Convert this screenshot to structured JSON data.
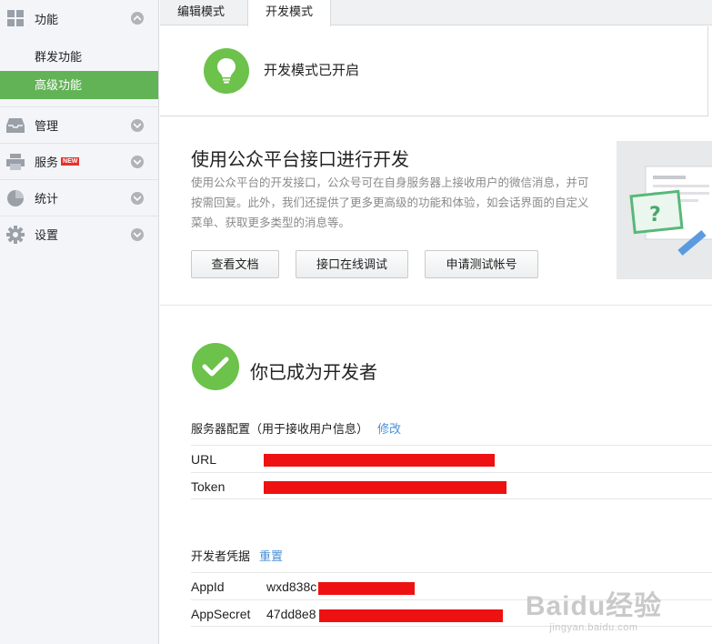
{
  "sidebar": {
    "sections": [
      {
        "label": "功能",
        "items": [
          "群发功能",
          "高级功能"
        ],
        "active_item": 1
      },
      {
        "label": "管理"
      },
      {
        "label": "服务",
        "badge": "NEW"
      },
      {
        "label": "统计"
      },
      {
        "label": "设置"
      }
    ]
  },
  "tabs": [
    "编辑模式",
    "开发模式"
  ],
  "active_tab": 1,
  "status": "开发模式已开启",
  "dev": {
    "title": "使用公众平台接口进行开发",
    "desc": "使用公众平台的开发接口，公众号可在自身服务器上接收用户的微信消息，并可按需回复。此外，我们还提供了更多更高级的功能和体验，如会话界面的自定义菜单、获取更多类型的消息等。",
    "buttons": [
      "查看文档",
      "接口在线调试",
      "申请测试帐号"
    ]
  },
  "developer_status": "你已成为开发者",
  "server_config": {
    "heading": "服务器配置（用于接收用户信息）",
    "edit_link": "修改",
    "rows": [
      {
        "key": "URL",
        "value": ""
      },
      {
        "key": "Token",
        "value": ""
      }
    ]
  },
  "credentials": {
    "heading": "开发者凭据",
    "reset_link": "重置",
    "rows": [
      {
        "key": "AppId",
        "value": "wxd838c"
      },
      {
        "key": "AppSecret",
        "value": "47dd8e8"
      }
    ]
  },
  "watermark": {
    "logo": "Baidu经验",
    "url": "jingyan.baidu.com"
  },
  "colors": {
    "accent_green": "#62b356",
    "link_blue": "#4a8fd6",
    "redaction_red": "#ee1111"
  }
}
